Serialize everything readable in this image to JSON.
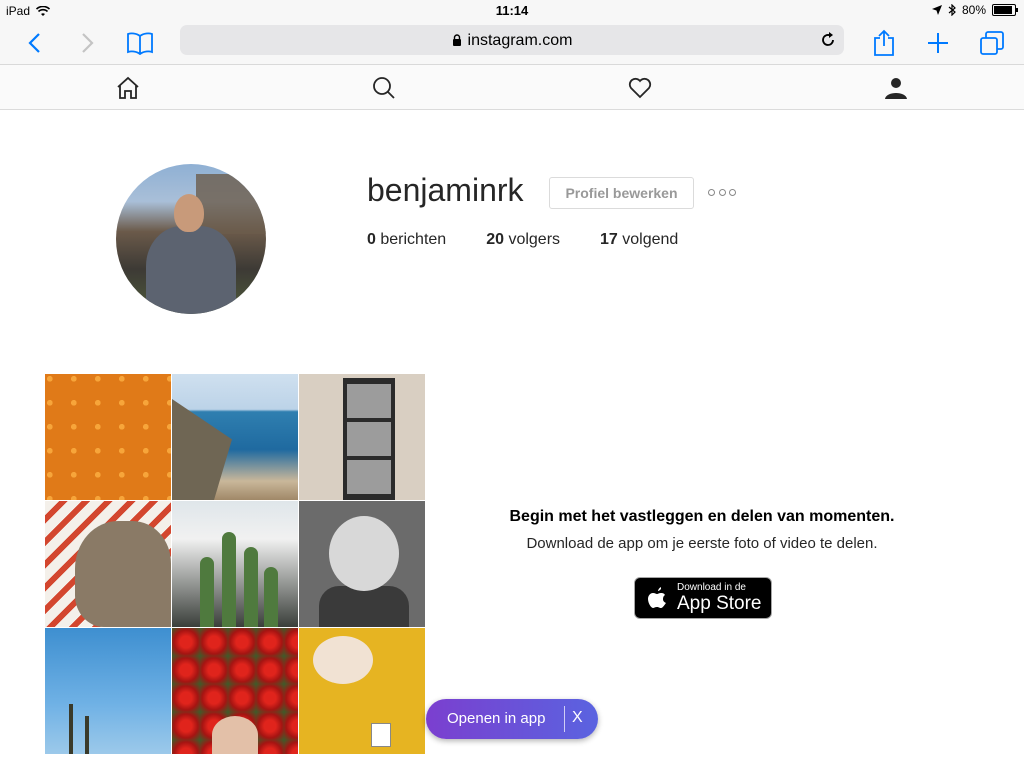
{
  "status_bar": {
    "device": "iPad",
    "time": "11:14",
    "battery": "80%"
  },
  "browser": {
    "url": "instagram.com"
  },
  "profile": {
    "username": "benjaminrk",
    "edit_label": "Profiel bewerken",
    "stats": [
      {
        "num": "0",
        "label": "berichten"
      },
      {
        "num": "20",
        "label": "volgers"
      },
      {
        "num": "17",
        "label": "volgend"
      }
    ]
  },
  "promo": {
    "title": "Begin met het vastleggen en delen van momenten.",
    "subtitle": "Download de app om je eerste foto of video te delen.",
    "badge_small": "Download in de",
    "badge_big": "App Store"
  },
  "open_app": {
    "label": "Openen in app",
    "close": "X"
  },
  "colors": {
    "accent": "#007aff",
    "pill_start": "#7b3fcf",
    "pill_end": "#5a63e0"
  }
}
